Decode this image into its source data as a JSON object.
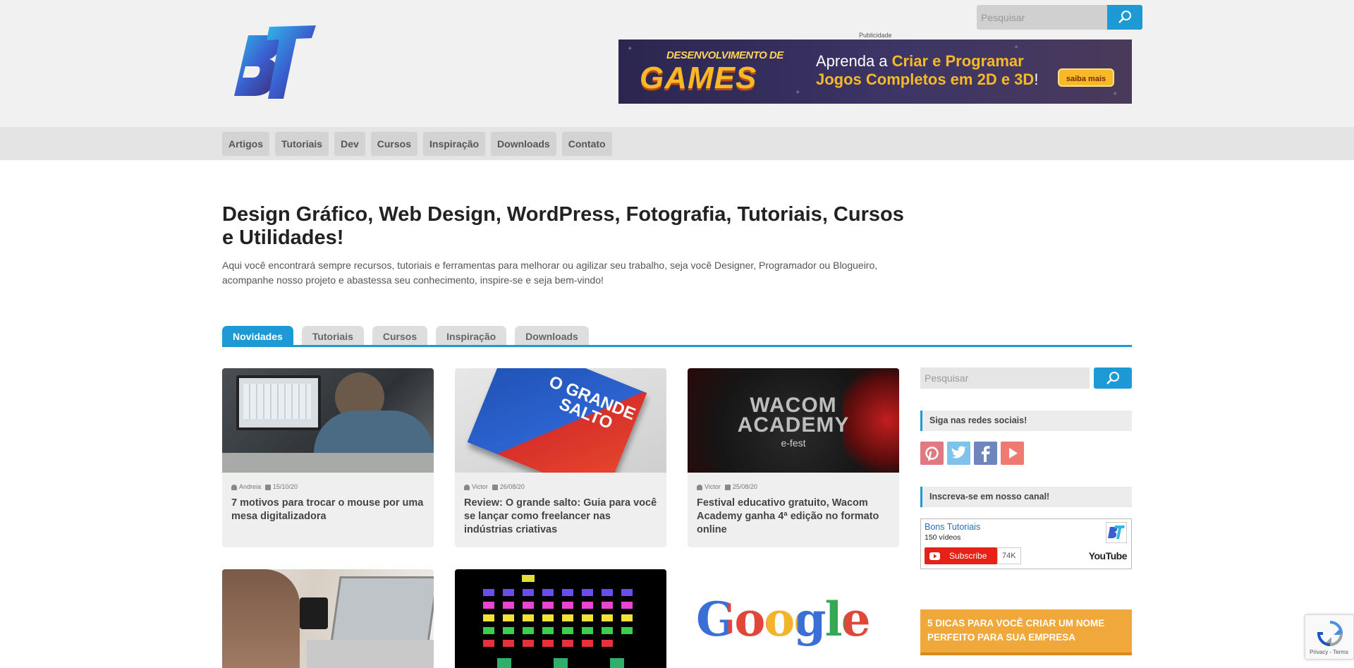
{
  "header": {
    "logo_text": "BT",
    "ad_label": "Publicidade",
    "ad": {
      "line1": "DESENVOLVIMENTO DE",
      "line2": "GAMES",
      "right1_pre": "Aprenda a ",
      "right1_hl": "Criar e Programar",
      "right2_hl": "Jogos Completos em 2D e 3D",
      "right2_post": "!",
      "button": "saiba mais"
    }
  },
  "nav": {
    "items": [
      "Artigos",
      "Tutoriais",
      "Dev",
      "Cursos",
      "Inspiração",
      "Downloads",
      "Contato"
    ],
    "search_placeholder": "Pesquisar"
  },
  "intro": {
    "title": "Design Gráfico, Web Design, WordPress, Fotografia, Tutoriais, Cursos e Utilidades!",
    "description": "Aqui você encontrará sempre recursos, tutoriais e ferramentas para melhorar ou agilizar seu trabalho, seja você Designer, Programador ou Blogueiro, acompanhe nosso projeto e abastessa seu conhecimento, inspire-se e seja bem-vindo!"
  },
  "tabs": [
    {
      "label": "Novidades",
      "active": true
    },
    {
      "label": "Tutoriais",
      "active": false
    },
    {
      "label": "Cursos",
      "active": false
    },
    {
      "label": "Inspiração",
      "active": false
    },
    {
      "label": "Downloads",
      "active": false
    }
  ],
  "posts": [
    {
      "author": "Andreia",
      "date": "15/10/20",
      "title": "7 motivos para trocar o mouse por uma mesa digitalizadora"
    },
    {
      "author": "Victor",
      "date": "26/08/20",
      "title": "Review: O grande salto: Guia para você se lançar como freelancer nas indústrias criativas",
      "cover_text": "O GRANDE SALTO"
    },
    {
      "author": "Victor",
      "date": "25/08/20",
      "title": "Festival educativo gratuito, Wacom Academy ganha 4ª edição no formato online",
      "cover_line1": "WACOM",
      "cover_line2": "ACADEMY",
      "cover_line3": "e-fest"
    }
  ],
  "posts_row2": {
    "third_logo": "Google"
  },
  "sidebar": {
    "search_placeholder": "Pesquisar",
    "social_heading": "Siga nas redes sociais!",
    "social": [
      "pinterest",
      "twitter",
      "facebook",
      "youtube"
    ],
    "channel_heading": "Inscreva-se em nosso canal!",
    "youtube": {
      "channel_name": "Bons Tutoriais",
      "videos": "150 vídeos",
      "subscribe": "Subscribe",
      "subscribers": "74K",
      "brand": "YouTube"
    },
    "promo": "5 DICAS PARA VOCÊ CRIAR UM NOME PERFEITO PARA SUA EMPRESA"
  },
  "recaptcha": {
    "links": "Privacy - Terms"
  },
  "colors": {
    "accent": "#1d9ad6",
    "promo": "#f0a83a"
  }
}
